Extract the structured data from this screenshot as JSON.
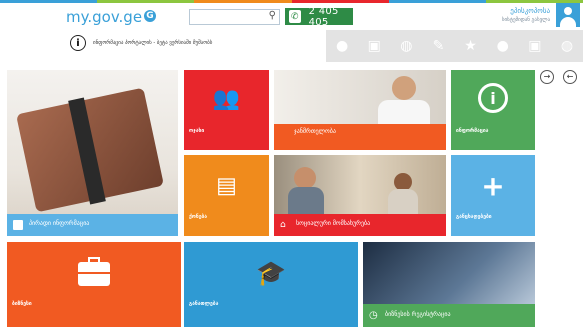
{
  "header": {
    "logo": "my.gov.ge",
    "phone_number": "2 405 405",
    "user_name": "ეპისკოპოსა",
    "user_sub": "სისტემიდან გასვლა"
  },
  "notice": "ინფორმაცია პორტალის - ბეტა ვერსიაში მუშაობს",
  "nav_arrows": {
    "prev": "→",
    "next": "←"
  },
  "tiles": {
    "private_info": "პირადი ინფორმაცია",
    "family": "ოჯახი",
    "health": "ჯანმრთელობა",
    "information": "ინფორმაცია",
    "property": "ქონება",
    "social": "სოციალური მომსახურება",
    "add": "განცხადებები",
    "business": "ბიზნესი",
    "education": "განათლება",
    "business_reg": "ბიზნესის რეგისტრაცია"
  },
  "colors": {
    "red": "#e8262c",
    "orange": "#f08b1c",
    "orange_red": "#f15a22",
    "green": "#50a85a",
    "light_blue": "#5bb2e5",
    "blue": "#2f9ad3"
  }
}
